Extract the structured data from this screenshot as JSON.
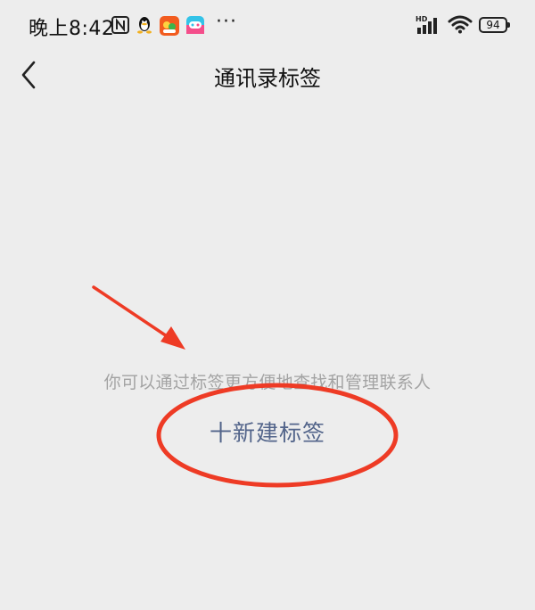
{
  "status_bar": {
    "time": "晚上8:42",
    "more": "···",
    "battery": "94",
    "network_badge": "HD"
  },
  "nav": {
    "title": "通讯录标签"
  },
  "main": {
    "hint": "你可以通过标签更方便地查找和管理联系人",
    "new_tag_label": "十新建标签"
  },
  "colors": {
    "background": "#ededed",
    "link": "#52648a",
    "hint": "#a3a3a3",
    "annotation": "#ee3b25"
  },
  "icons": [
    "back-chevron-icon",
    "nfc-icon",
    "qq-penguin-icon",
    "taobao-app-icon",
    "game-app-icon",
    "cellular-signal-icon",
    "wifi-icon",
    "battery-icon"
  ]
}
